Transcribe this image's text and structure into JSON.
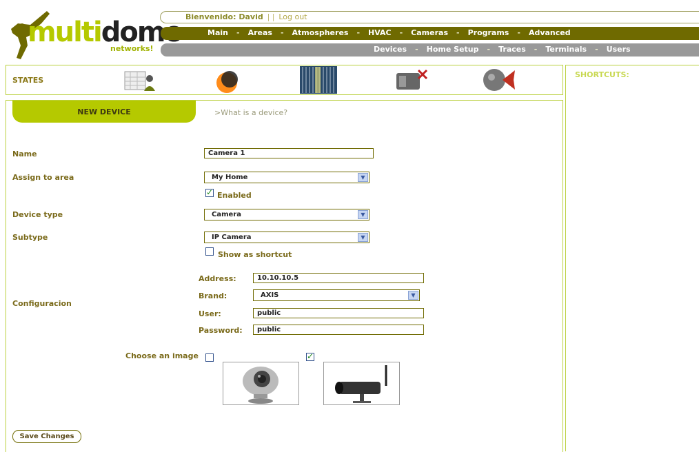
{
  "brand": {
    "logo_main": "multidomo",
    "logo_sub": "networks!"
  },
  "header": {
    "welcome_label": "Bienvenido: David",
    "separator": "| |",
    "logout_label": "Log out"
  },
  "main_nav": [
    "Main",
    "Areas",
    "Atmospheres",
    "HVAC",
    "Cameras",
    "Programs",
    "Advanced"
  ],
  "sub_nav": [
    "Devices",
    "Home Setup",
    "Traces",
    "Terminals",
    "Users"
  ],
  "states": {
    "title": "STATES",
    "icons": [
      "calendar-person-icon",
      "sun-eclipse-icon",
      "blinds-icon",
      "camera-alarm-icon",
      "speaker-sphere-icon"
    ]
  },
  "shortcuts": {
    "title": "SHORTCUTS:"
  },
  "form": {
    "tab_label": "NEW DEVICE",
    "help_link": ">What is a device?",
    "name_label": "Name",
    "name_value": "Camera 1",
    "area_label": "Assign to area",
    "area_value": "My Home",
    "enabled_label": "Enabled",
    "enabled_checked": true,
    "device_type_label": "Device type",
    "device_type_value": "Camera",
    "subtype_label": "Subtype",
    "subtype_value": "IP Camera",
    "shortcut_label": "Show as shortcut",
    "shortcut_checked": false,
    "config_label": "Configuracion",
    "address_label": "Address:",
    "address_value": "10.10.10.5",
    "brand_label": "Brand:",
    "brand_value": "AXIS",
    "user_label": "User:",
    "user_value": "public",
    "password_label": "Password:",
    "password_value": "public",
    "image_label": "Choose an image",
    "image_options": [
      {
        "name": "webcam-image",
        "checked": false
      },
      {
        "name": "ip-camera-image",
        "checked": true
      }
    ],
    "save_label": "Save Changes"
  },
  "colors": {
    "accent_green": "#b5c900",
    "nav_olive": "#6f6a00",
    "nav_grey": "#999999",
    "label_brown": "#7a6a1a"
  }
}
